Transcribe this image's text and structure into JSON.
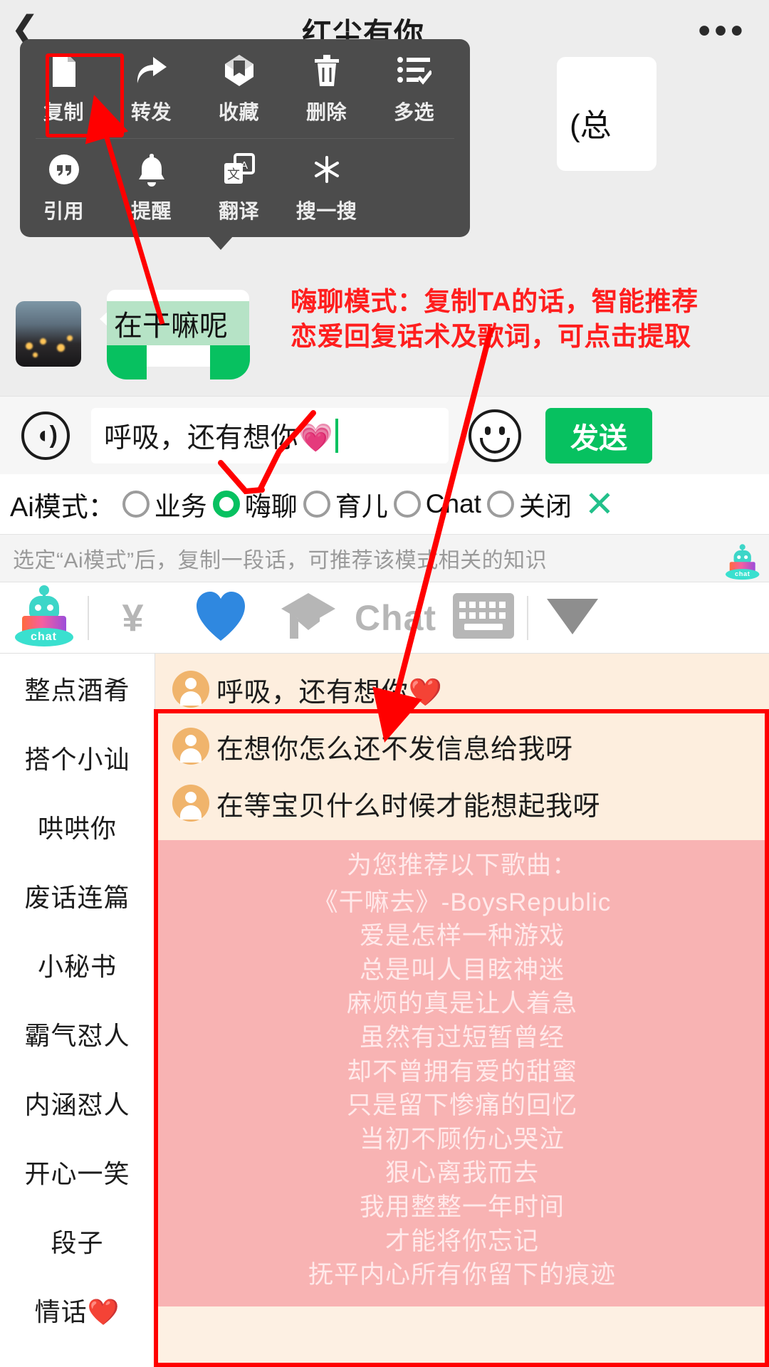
{
  "header": {
    "title": "红尘有你",
    "back_icon": "back-chevron-icon",
    "more_icon": "more-dots-icon"
  },
  "peek_bubble": {
    "text": "(总"
  },
  "context_menu": {
    "row1": [
      {
        "label": "复制",
        "icon": "copy-icon",
        "highlighted": true
      },
      {
        "label": "转发",
        "icon": "forward-arrow-icon"
      },
      {
        "label": "收藏",
        "icon": "favorite-box-icon"
      },
      {
        "label": "删除",
        "icon": "trash-icon"
      },
      {
        "label": "多选",
        "icon": "multi-select-icon"
      }
    ],
    "row2": [
      {
        "label": "引用",
        "icon": "quote-icon"
      },
      {
        "label": "提醒",
        "icon": "bell-icon"
      },
      {
        "label": "翻译",
        "icon": "translate-icon"
      },
      {
        "label": "搜一搜",
        "icon": "search-dandelion-icon"
      }
    ]
  },
  "message": {
    "avatar": "contact-avatar",
    "text": "在干嘛呢",
    "selected": true
  },
  "annotation": {
    "line1": "嗨聊模式：复制TA的话，智能推荐",
    "line2": "恋爱回复话术及歌词，可点击提取"
  },
  "input_bar": {
    "voice_icon": "voice-wave-icon",
    "value": "呼吸，还有想你💗",
    "placeholder": "",
    "emoji_icon": "smiley-icon",
    "send_label": "发送"
  },
  "ai_mode": {
    "label": "Ai模式：",
    "options": [
      {
        "label": "业务",
        "selected": false
      },
      {
        "label": "嗨聊",
        "selected": true
      },
      {
        "label": "育儿",
        "selected": false
      },
      {
        "label": "Chat",
        "selected": false
      },
      {
        "label": "关闭",
        "selected": false
      }
    ],
    "close_icon": "close-x-icon"
  },
  "hint": {
    "text": "选定“Ai模式”后，复制一段话，可推荐该模式相关的知识",
    "badge_icon": "robot-chat-icon"
  },
  "toolbar": {
    "items": [
      {
        "name": "robot-chat-icon",
        "label": "chat"
      },
      {
        "name": "yen-icon",
        "label": "¥"
      },
      {
        "name": "heart-icon",
        "label": ""
      },
      {
        "name": "graduation-cap-icon",
        "label": ""
      },
      {
        "name": "chat-word",
        "label": "Chat"
      },
      {
        "name": "keyboard-icon",
        "label": ""
      },
      {
        "name": "chevron-down-triangle-icon",
        "label": ""
      }
    ]
  },
  "sidebar": {
    "items": [
      {
        "label": "整点酒肴"
      },
      {
        "label": "搭个小讪"
      },
      {
        "label": "哄哄你"
      },
      {
        "label": "废话连篇"
      },
      {
        "label": "小秘书"
      },
      {
        "label": "霸气怼人"
      },
      {
        "label": "内涵怼人"
      },
      {
        "label": "开心一笑"
      },
      {
        "label": "段子"
      },
      {
        "label": "情话❤️"
      }
    ]
  },
  "suggestions": [
    {
      "text": "呼吸，还有想你❤️"
    },
    {
      "text": "在想你怎么还不发信息给我呀"
    },
    {
      "text": "在等宝贝什么时候才能想起我呀"
    }
  ],
  "lyrics": {
    "heading": "为您推荐以下歌曲：",
    "song": "《干嘛去》-BoysRepublic",
    "lines": [
      "爱是怎样一种游戏",
      "总是叫人目眩神迷",
      "麻烦的真是让人着急",
      "虽然有过短暂曾经",
      "却不曾拥有爱的甜蜜",
      "只是留下惨痛的回忆",
      "当初不顾伤心哭泣",
      "狠心离我而去",
      "我用整整一年时间",
      "才能将你忘记",
      "抚平内心所有你留下的痕迹"
    ]
  },
  "colors": {
    "accent_green": "#07c160",
    "annotation_red": "#ff1e1e",
    "bubble_select": "#b6e3c6",
    "suggestion_bg": "#fdeede",
    "lyrics_bg": "#f8b3b3"
  }
}
